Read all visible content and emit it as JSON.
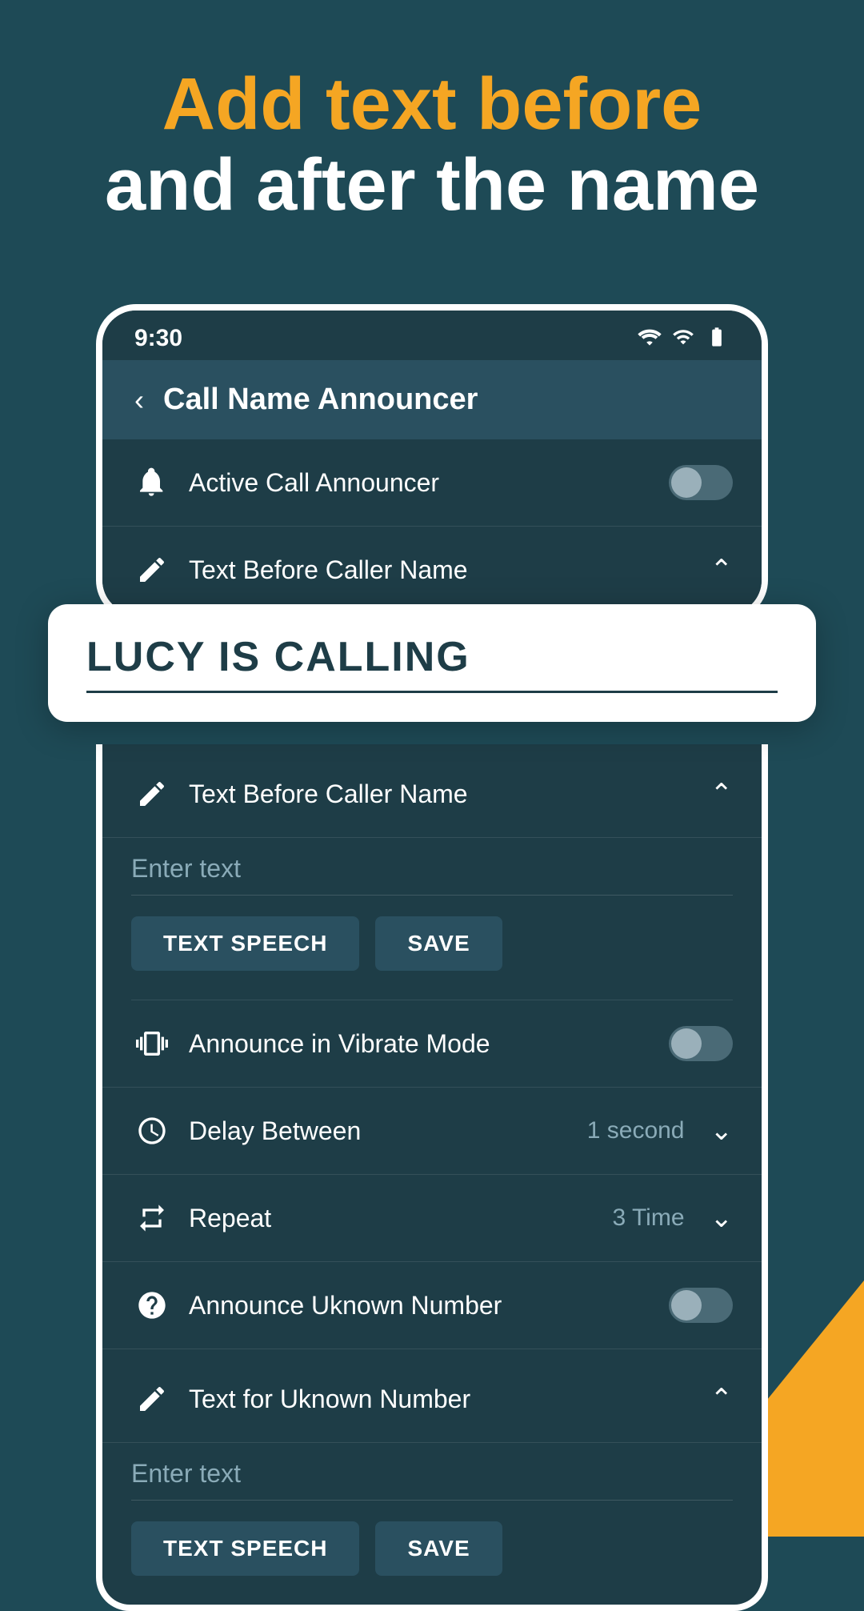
{
  "hero": {
    "title_yellow": "Add text before",
    "title_white": "and after the name"
  },
  "status_bar": {
    "time": "9:30"
  },
  "app_header": {
    "title": "Call Name Announcer",
    "back_label": "‹"
  },
  "call_bubble": {
    "text": "LUCY IS CALLING"
  },
  "settings": {
    "active_call_announcer": "Active Call Announcer",
    "text_before_caller_name_top": "Text Before Caller Name",
    "text_before_caller_name_bottom": "Text Before Caller Name",
    "enter_text_placeholder_top": "Enter text",
    "btn_text_speech_top": "TEXT SPEECH",
    "btn_save_top": "SAVE",
    "announce_vibrate": "Announce in Vibrate Mode",
    "delay_between": "Delay Between",
    "delay_value": "1 second",
    "repeat": "Repeat",
    "repeat_value": "3 Time",
    "announce_unknown": "Announce Uknown Number",
    "text_unknown": "Text for Uknown Number",
    "enter_text_placeholder_bottom": "Enter text",
    "btn_text_speech_bottom": "TEXT SPEECH",
    "btn_save_bottom": "SAVE"
  }
}
